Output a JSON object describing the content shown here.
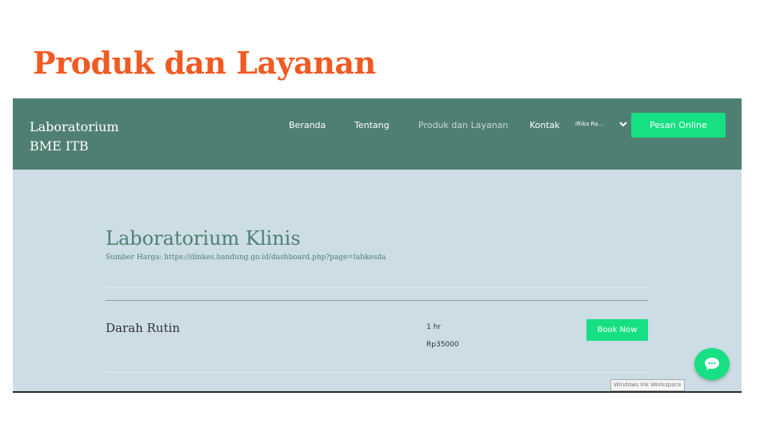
{
  "slide": {
    "title": "Produk dan Layanan"
  },
  "site": {
    "brand_line1": "Laboratorium",
    "brand_line2": "BME ITB",
    "nav": {
      "beranda": "Beranda",
      "tentang": "Tentang",
      "produk": "Produk dan Layanan",
      "kontak": "Kontak"
    },
    "user_menu": "Iftika Ra...",
    "order_button": "Pesan Online"
  },
  "section": {
    "title": "Laboratorium Klinis",
    "price_source": "Sumber Harga: https://dinkes.bandung.go.id/dashboard.php?page=labkesda"
  },
  "service": {
    "name": "Darah Rutin",
    "duration": "1 hr",
    "price": "Rp35000",
    "book_label": "Book Now"
  },
  "tooltip": "Windows Ink Workspace",
  "colors": {
    "slide_title": "#f15a22",
    "header_bg": "#4f7f72",
    "page_bg": "#cddde5",
    "accent_green": "#16e083"
  },
  "icons": {
    "chevron": "chevron-down-icon",
    "chat": "chat-bubble-icon"
  }
}
